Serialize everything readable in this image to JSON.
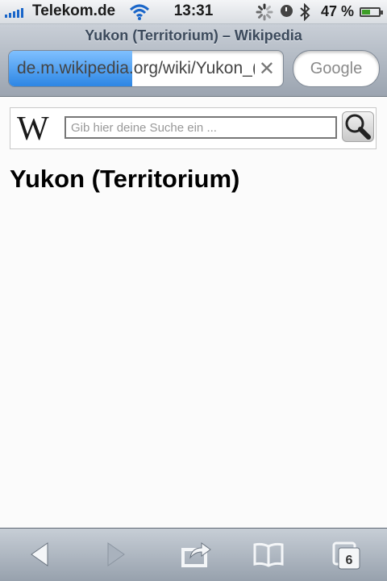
{
  "status_bar": {
    "carrier": "Telekom.de",
    "time": "13:31",
    "battery": "47 %",
    "icons": [
      "signal-icon",
      "wifi-icon",
      "activity-icon",
      "clock-icon",
      "bluetooth-icon",
      "battery-icon"
    ]
  },
  "browser": {
    "page_title": "Yukon (Territorium) – Wikipedia",
    "url": "de.m.wikipedia.org/wiki/Yukon_(Territorium)",
    "load_progress": 0.45,
    "search_placeholder": "Google"
  },
  "wiki": {
    "logo": "W",
    "search_placeholder": "Gib hier deine Suche ein ...",
    "article_title": "Yukon (Territorium)"
  },
  "toolbar": {
    "tab_count": "6",
    "icons": [
      "back-icon",
      "forward-icon",
      "share-icon",
      "bookmarks-icon",
      "tabs-icon"
    ]
  },
  "colors": {
    "progress": "#2d86e4",
    "signal": "#1a66c9",
    "battery": "#3d9e27"
  }
}
